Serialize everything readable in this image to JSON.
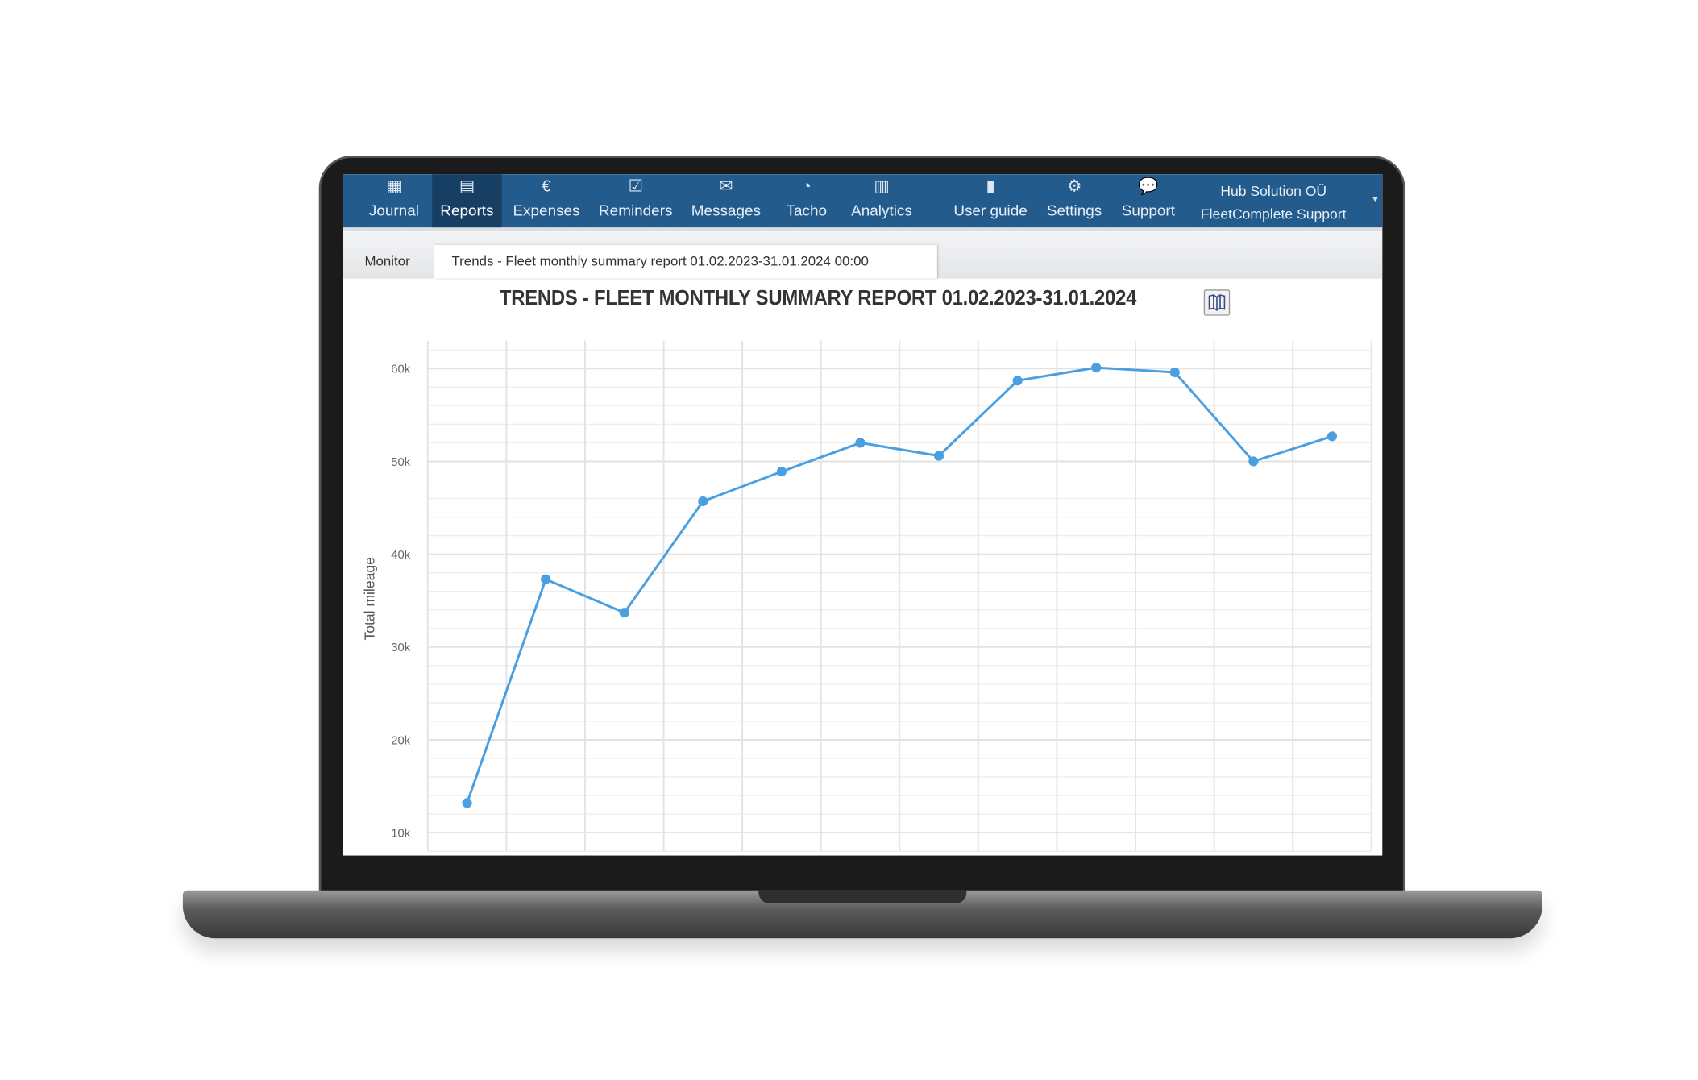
{
  "nav": {
    "items": [
      {
        "label": "Journal",
        "icon": "calendar-icon",
        "active": false
      },
      {
        "label": "Reports",
        "icon": "document-icon",
        "active": true
      },
      {
        "label": "Expenses",
        "icon": "euro-icon",
        "active": false
      },
      {
        "label": "Reminders",
        "icon": "calendar-check-icon",
        "active": false
      },
      {
        "label": "Messages",
        "icon": "envelope-icon",
        "active": false
      },
      {
        "label": "Tacho",
        "icon": "gauge-icon",
        "active": false
      },
      {
        "label": "Analytics",
        "icon": "bar-chart-icon",
        "active": false
      },
      {
        "label": "User guide",
        "icon": "book-icon",
        "active": false
      },
      {
        "label": "Settings",
        "icon": "gears-icon",
        "active": false
      },
      {
        "label": "Support",
        "icon": "chat-icon",
        "active": false
      }
    ],
    "account": {
      "company": "Hub Solution OÜ",
      "user": "FleetComplete Support"
    }
  },
  "tabs": [
    {
      "label": "Monitor",
      "active": false
    },
    {
      "label": "Trends - Fleet monthly summary report 01.02.2023-31.01.2024 00:00",
      "active": true
    }
  ],
  "colors": {
    "nav": "#235b8d",
    "nav_active": "#173f64",
    "series": "#4a9fe0",
    "grid": "#e6e6e6"
  },
  "chart_data": {
    "type": "line",
    "title": "TRENDS - FLEET MONTHLY SUMMARY REPORT 01.02.2023-31.01.2024",
    "ylabel": "Total mileage",
    "xlabel": "",
    "yticks": [
      "10k",
      "20k",
      "30k",
      "40k",
      "50k",
      "60k"
    ],
    "ylim": [
      8000,
      63000
    ],
    "grid": true,
    "series": [
      {
        "values": [
          13200,
          37300,
          33700,
          45700,
          48900,
          52000,
          50600,
          58700,
          60100,
          59600,
          50000,
          52700
        ]
      }
    ]
  }
}
